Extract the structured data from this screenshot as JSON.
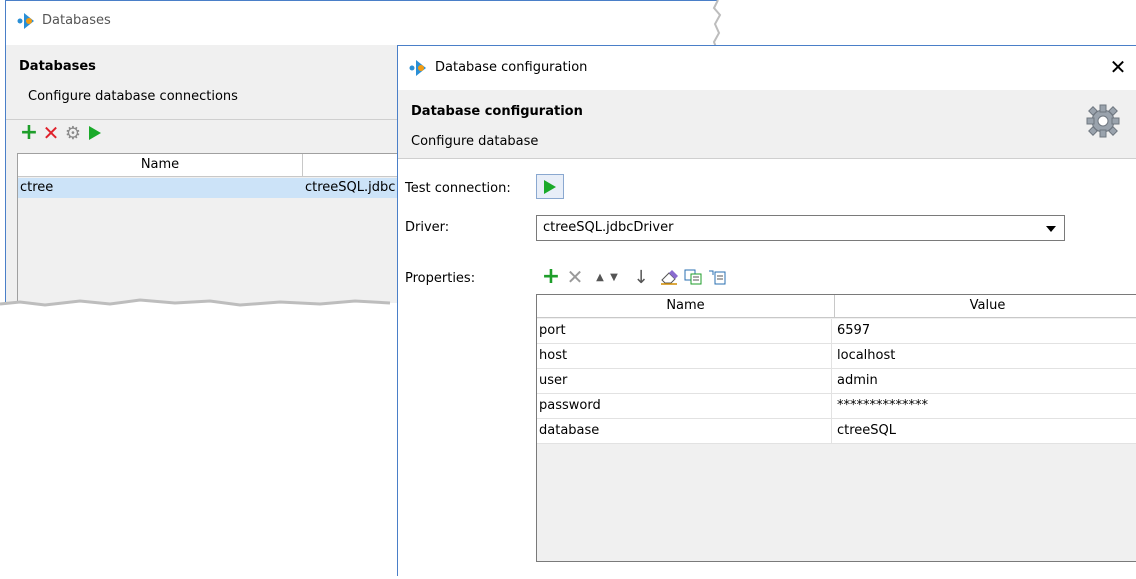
{
  "bg_window": {
    "title": "Databases",
    "header_title": "Databases",
    "header_subtitle": "Configure database connections",
    "table": {
      "columns": [
        "Name",
        ""
      ],
      "rows": [
        {
          "name": "ctree",
          "driver": "ctreeSQL.jdbc"
        }
      ]
    }
  },
  "dialog": {
    "title": "Database configuration",
    "header_title": "Database configuration",
    "header_subtitle": "Configure database",
    "test_connection_label": "Test connection:",
    "driver_label": "Driver:",
    "driver_value": "ctreeSQL.jdbcDriver",
    "properties_label": "Properties:",
    "properties_table": {
      "columns": [
        "Name",
        "Value"
      ],
      "rows": [
        {
          "name": "port",
          "value": "6597"
        },
        {
          "name": "host",
          "value": "localhost"
        },
        {
          "name": "user",
          "value": "admin"
        },
        {
          "name": "password",
          "value": "**************"
        },
        {
          "name": "database",
          "value": "ctreeSQL"
        }
      ]
    },
    "close_glyph": "✕"
  },
  "colors": {
    "accent": "#4a7fc8",
    "add_green": "#1e9e2a",
    "delete_red": "#e0212b",
    "selection": "#cce3f8",
    "logo_blue": "#2a8fd6",
    "logo_orange": "#f39c12"
  }
}
